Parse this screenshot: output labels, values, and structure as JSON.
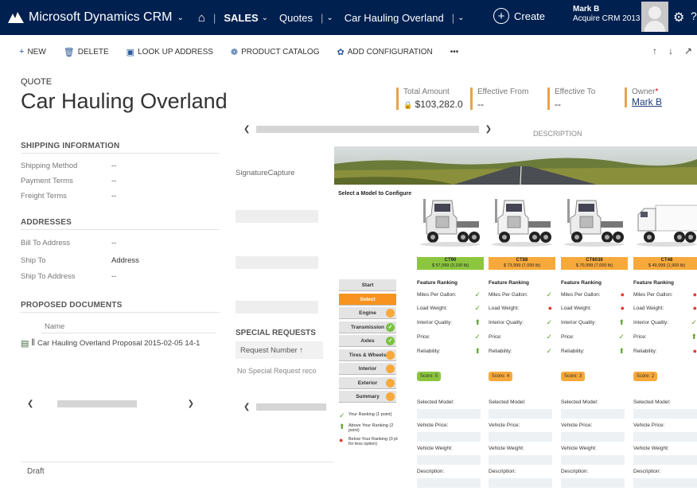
{
  "nav": {
    "app_name": "Microsoft Dynamics CRM",
    "area": "SALES",
    "entity": "Quotes",
    "record": "Car Hauling Overland",
    "create": "Create",
    "user_name": "Mark B",
    "user_org": "Acquire CRM 2013",
    "help": "?"
  },
  "commands": [
    {
      "label": "NEW",
      "icon": "plus-icon",
      "glyph": "+"
    },
    {
      "label": "DELETE",
      "icon": "trash-icon",
      "glyph": "🗑"
    },
    {
      "label": "LOOK UP ADDRESS",
      "icon": "address-book-icon",
      "glyph": "▣"
    },
    {
      "label": "PRODUCT CATALOG",
      "icon": "catalog-icon",
      "glyph": "❁"
    },
    {
      "label": "ADD CONFIGURATION",
      "icon": "configuration-icon",
      "glyph": "✿"
    },
    {
      "label": "•••",
      "icon": "more-icon",
      "glyph": ""
    }
  ],
  "record": {
    "entity_type": "QUOTE",
    "title": "Car Hauling Overland"
  },
  "header_fields": {
    "total_amount_label": "Total Amount",
    "total_amount_value": "$103,282.0",
    "effective_from_label": "Effective From",
    "effective_from_value": "--",
    "effective_to_label": "Effective To",
    "effective_to_value": "--",
    "owner_label": "Owner",
    "owner_value": "Mark B"
  },
  "shipping": {
    "heading": "SHIPPING INFORMATION",
    "method_label": "Shipping Method",
    "method_value": "--",
    "payment_label": "Payment Terms",
    "payment_value": "--",
    "freight_label": "Freight Terms",
    "freight_value": "--"
  },
  "addresses": {
    "heading": "ADDRESSES",
    "bill_label": "Bill To Address",
    "bill_value": "--",
    "ship_label": "Ship To",
    "ship_value": "Address",
    "ship_addr_label": "Ship To Address",
    "ship_addr_value": "--"
  },
  "documents": {
    "heading": "PROPOSED DOCUMENTS",
    "name_col": "Name",
    "row": "Car Hauling Overland Proposal 2015-02-05 14-1"
  },
  "middle": {
    "signature_label": "SignatureCapture",
    "description_label": "DESCRIPTION",
    "special_heading": "SPECIAL REQUESTS",
    "request_col": "Request Number ↑",
    "empty_text": "No Special Request reco"
  },
  "status": "Draft",
  "configurator": {
    "title": "Select a Model to Configure",
    "steps": [
      {
        "label": "Start",
        "state": "none"
      },
      {
        "label": "Select",
        "state": "active"
      },
      {
        "label": "Engine",
        "state": "orange"
      },
      {
        "label": "Transmission",
        "state": "green"
      },
      {
        "label": "Axles",
        "state": "green"
      },
      {
        "label": "Tires & Wheels",
        "state": "orange"
      },
      {
        "label": "Interior",
        "state": "orange"
      },
      {
        "label": "Exterior",
        "state": "orange"
      },
      {
        "label": "Summary",
        "state": "orange"
      }
    ],
    "legend": [
      {
        "text": "Your Ranking (1 point)",
        "symbol": "✓",
        "color": "#5aa02c"
      },
      {
        "text": "Above Your Ranking (2 point)",
        "symbol": "⬆",
        "color": "#5aa02c"
      },
      {
        "text": "Below Your Ranking (0 pt for less option)",
        "symbol": "●",
        "color": "#e23a2f"
      }
    ],
    "feature_heading": "Feature Ranking",
    "feature_labels": [
      "Miles Per Gallon:",
      "Load Weight:",
      "Interior Quality:",
      "Price:",
      "Reliability:"
    ],
    "selection_labels": [
      "Selected Model:",
      "Vehicle Price:",
      "Vehicle Weight:",
      "Description:"
    ],
    "models": [
      {
        "name": "CT90",
        "price": "$ 57,999 (3,100 lb)",
        "color": "#8cc63f",
        "marks": [
          "check",
          "check",
          "up",
          "check",
          "up"
        ],
        "score": "Score: 5"
      },
      {
        "name": "CT88",
        "price": "$ 73,999 (7,000 lb)",
        "color": "#f7a93b",
        "marks": [
          "check",
          "down",
          "check",
          "check",
          "check"
        ],
        "score": "Score: 4"
      },
      {
        "name": "CT8036",
        "price": "$ 70,999 (7,000 lb)",
        "color": "#f7a93b",
        "marks": [
          "down",
          "down",
          "up",
          "check",
          "up"
        ],
        "score": "Score: 3"
      },
      {
        "name": "CT48",
        "price": "$ 49,999 (1,900 lb)",
        "color": "#f7a93b",
        "marks": [
          "down",
          "down",
          "check",
          "up",
          "down"
        ],
        "score": "Score: 2"
      }
    ]
  }
}
